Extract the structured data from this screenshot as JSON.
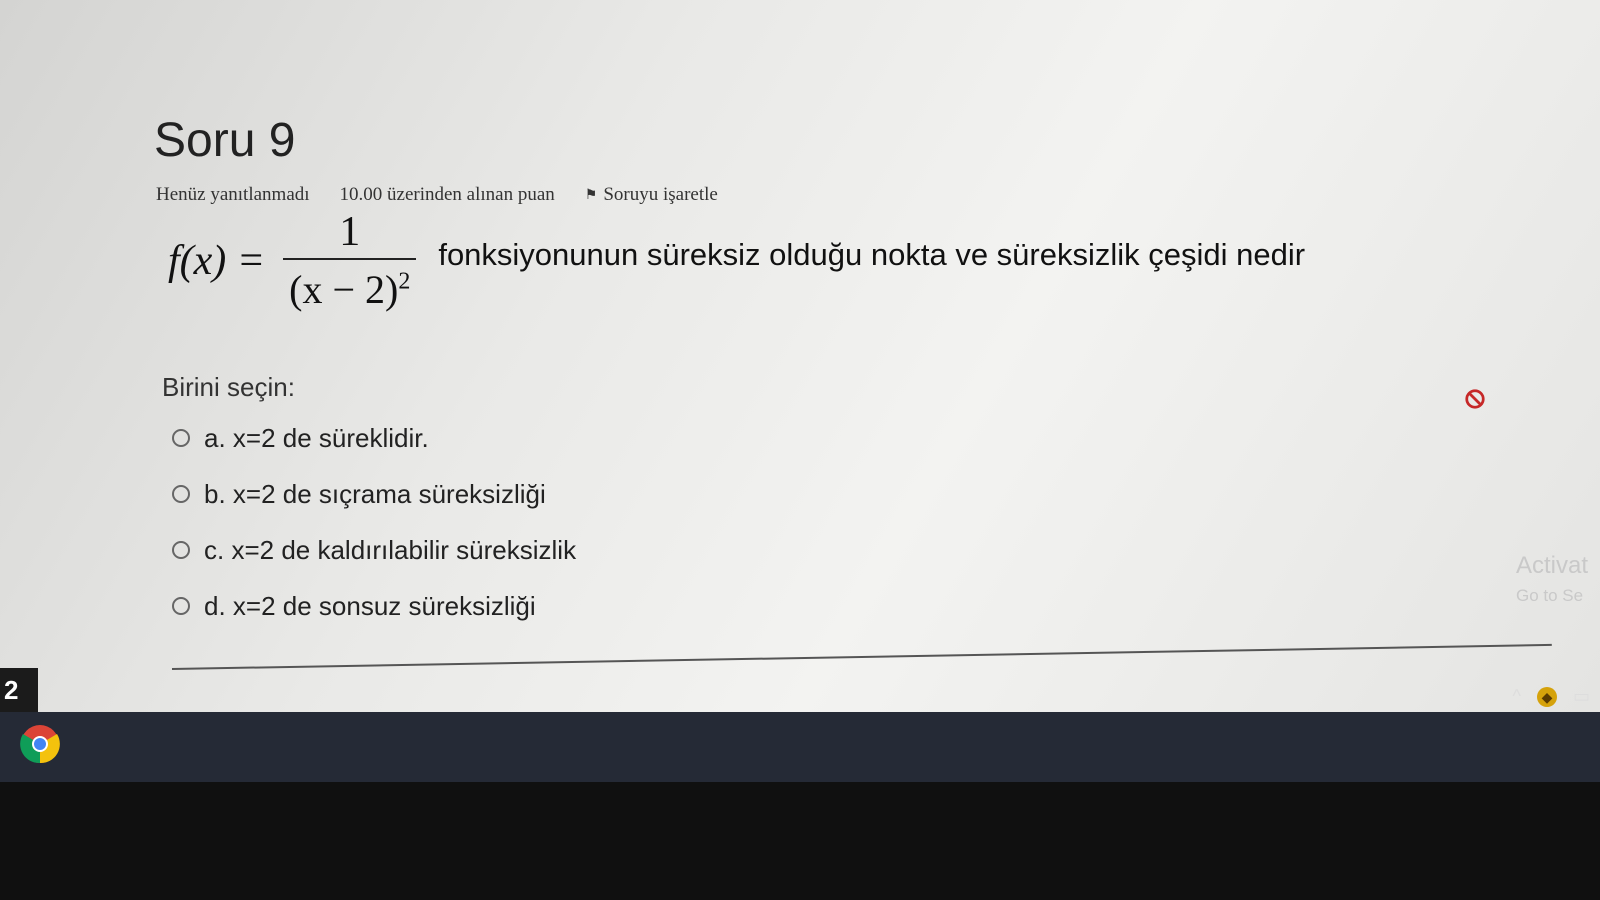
{
  "question": {
    "title": "Soru 9",
    "status": "Henüz yanıtlanmadı",
    "points": "10.00 üzerinden alınan puan",
    "flag_label": "Soruyu işaretle",
    "formula_lhs": "f(x) =",
    "formula_numerator": "1",
    "formula_denominator_base": "(x − 2)",
    "formula_denominator_exp": "2",
    "text": "fonksiyonunun süreksiz olduğu nokta ve süreksizlik çeşidi nedir",
    "prompt": "Birini seçin:",
    "options": [
      {
        "label": "a. x=2 de süreklidir."
      },
      {
        "label": "b. x=2 de sıçrama süreksizliği"
      },
      {
        "label": "c. x=2 de kaldırılabilir süreksizlik"
      },
      {
        "label": "d. x=2 de sonsuz süreksizliği"
      }
    ]
  },
  "watermark": {
    "line1": "Activat",
    "line2": "Go to Se"
  },
  "page_number": "2",
  "icons": {
    "flag": "flag-icon",
    "clear": "prohibit-icon",
    "browser": "chrome-icon",
    "tray_up": "chevron-up-icon"
  },
  "colors": {
    "clear_icon": "#c62828",
    "taskbar": "#252a36"
  }
}
